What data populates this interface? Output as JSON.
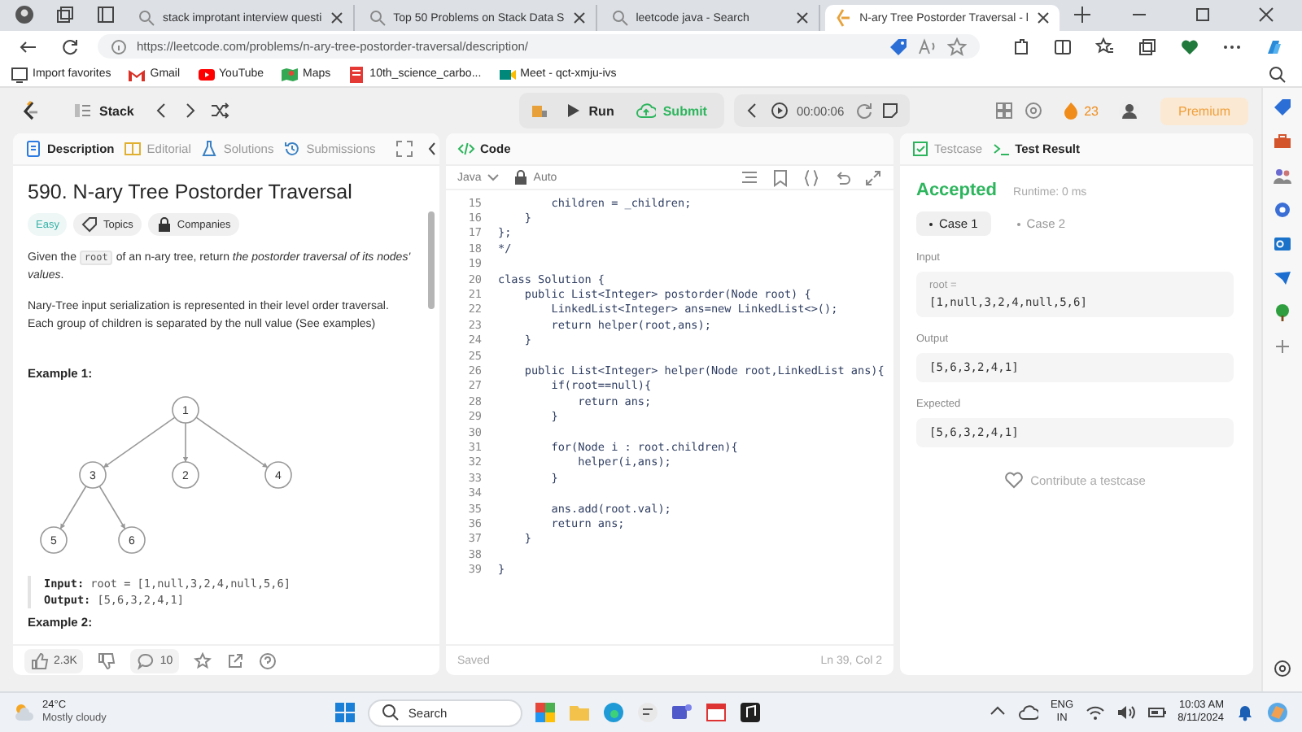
{
  "browser": {
    "tabs": [
      {
        "title": "stack improtant interview questi",
        "selected": false
      },
      {
        "title": "Top 50 Problems on Stack Data S",
        "selected": false
      },
      {
        "title": "leetcode java - Search",
        "selected": false
      },
      {
        "title": "N-ary Tree Postorder Traversal - l",
        "selected": true
      }
    ],
    "url": "https://leetcode.com/problems/n-ary-tree-postorder-traversal/description/",
    "bookmarks": [
      {
        "label": "Import favorites",
        "kind": "import"
      },
      {
        "label": "Gmail",
        "kind": "mail"
      },
      {
        "label": "YouTube",
        "kind": "video"
      },
      {
        "label": "Maps",
        "kind": "map"
      },
      {
        "label": "10th_science_carbo...",
        "kind": "pdf"
      },
      {
        "label": "Meet - qct-xmju-ivs",
        "kind": "meet"
      }
    ]
  },
  "topbar": {
    "list": "Stack",
    "run": "Run",
    "submit": "Submit",
    "timer": "00:00:06",
    "streak": "23",
    "premium": "Premium"
  },
  "description": {
    "tabs": [
      {
        "label": "Description",
        "selected": true
      },
      {
        "label": "Editorial",
        "selected": false
      },
      {
        "label": "Solutions",
        "selected": false
      },
      {
        "label": "Submissions",
        "selected": false
      }
    ],
    "title": "590. N-ary Tree Postorder Traversal",
    "tags": [
      {
        "label": "Easy",
        "kind": "difficulty"
      },
      {
        "label": "Topics",
        "kind": "topics"
      },
      {
        "label": "Companies",
        "kind": "companies"
      }
    ],
    "paragraphs": [
      [
        {
          "text": "Given the "
        },
        {
          "text": "root",
          "kind": "code"
        },
        {
          "text": " of an n-ary tree, return *the postorder traversal of its nodes' values*."
        }
      ],
      [
        {
          "text": "Nary-Tree input serialization is represented in their level order traversal. Each group of children is separated by the null value (See examples)"
        }
      ]
    ],
    "example": {
      "heading": "Example 1:",
      "tree": {
        "label": "1",
        "children": [
          {
            "label": "3",
            "children": [
              {
                "label": "5"
              },
              {
                "label": "6"
              }
            ]
          },
          {
            "label": "2"
          },
          {
            "label": "4"
          }
        ]
      },
      "lines": [
        {
          "label": "Input:",
          "value": " root = [1,null,3,2,4,null,5,6]"
        },
        {
          "label": "Output:",
          "value": " [5,6,3,2,4,1]"
        }
      ]
    },
    "next_heading": "Example 2:",
    "likes": "2.3K",
    "comments": "10"
  },
  "code": {
    "title": "Code",
    "language": "Java",
    "mode": "Auto",
    "lines": [
      {
        "number": "15",
        "text": "        children = _children;"
      },
      {
        "number": "16",
        "text": "    }"
      },
      {
        "number": "17",
        "text": "};"
      },
      {
        "number": "18",
        "text": "*/"
      },
      {
        "number": "19"
      },
      {
        "number": "20",
        "text": "class Solution {"
      },
      {
        "number": "21",
        "text": "    public List<Integer> postorder(Node root) {"
      },
      {
        "number": "22",
        "text": "        LinkedList<Integer> ans=new LinkedList<>();"
      },
      {
        "number": "23",
        "text": "        return helper(root,ans);"
      },
      {
        "number": "24",
        "text": "    }"
      },
      {
        "number": "25"
      },
      {
        "number": "26",
        "text": "    public List<Integer> helper(Node root,LinkedList ans){"
      },
      {
        "number": "27",
        "text": "        if(root==null){"
      },
      {
        "number": "28",
        "text": "            return ans;"
      },
      {
        "number": "29",
        "text": "        }"
      },
      {
        "number": "30"
      },
      {
        "number": "31",
        "text": "        for(Node i : root.children){"
      },
      {
        "number": "32",
        "text": "            helper(i,ans);"
      },
      {
        "number": "33",
        "text": "        }"
      },
      {
        "number": "34"
      },
      {
        "number": "35",
        "text": "        ans.add(root.val);"
      },
      {
        "number": "36",
        "text": "        return ans;"
      },
      {
        "number": "37",
        "text": "    }"
      },
      {
        "number": "38"
      },
      {
        "number": "39",
        "text": "}"
      }
    ],
    "status": "Saved",
    "cursor": "Ln 39, Col 2"
  },
  "result": {
    "tabs": [
      {
        "label": "Testcase",
        "selected": false
      },
      {
        "label": "Test Result",
        "selected": true
      }
    ],
    "verdict": "Accepted",
    "runtime": "Runtime: 0 ms",
    "cases": [
      {
        "label": "Case 1",
        "selected": true
      },
      {
        "label": "Case 2",
        "selected": false
      }
    ],
    "input_label": "Input",
    "input_name": "root =",
    "input_value": "[1,null,3,2,4,null,5,6]",
    "output_label": "Output",
    "output_value": "[5,6,3,2,4,1]",
    "expected_label": "Expected",
    "expected_value": "[5,6,3,2,4,1]",
    "contribute": "Contribute a testcase"
  },
  "taskbar": {
    "temperature": "24°C",
    "weather": "Mostly cloudy",
    "search": "Search",
    "language": "ENG",
    "region": "IN",
    "time": "10:03 AM",
    "date": "8/11/2024"
  }
}
